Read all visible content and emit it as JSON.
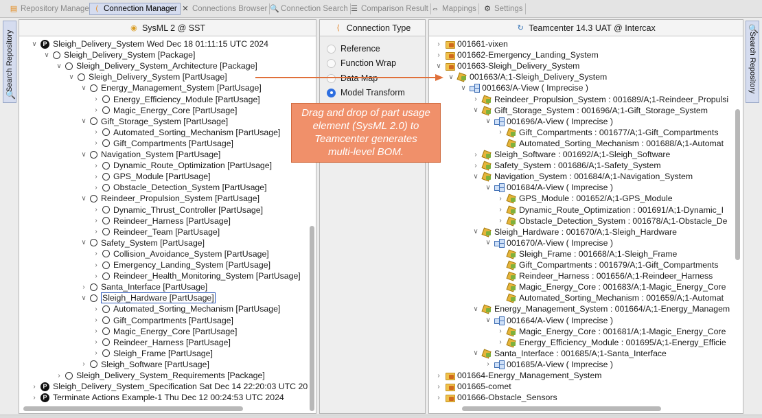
{
  "tabs": [
    {
      "label": "Repository Manager",
      "icon": "database-icon",
      "active": false
    },
    {
      "label": "Connection Manager",
      "icon": "connection-icon",
      "active": true
    },
    {
      "label": "Connections Browser",
      "icon": "cross-arrows-icon",
      "active": false
    },
    {
      "label": "Connection Search",
      "icon": "search-icon",
      "active": false
    },
    {
      "label": "Comparison Result",
      "icon": "list-icon",
      "active": false
    },
    {
      "label": "Mappings",
      "icon": "bidirectional-arrow-icon",
      "active": false
    },
    {
      "label": "Settings",
      "icon": "gear-icon",
      "active": false
    }
  ],
  "side_tabs": {
    "left": "Search Repository",
    "right": "Search Repository"
  },
  "left_panel": {
    "title": "SysML 2 @ SST",
    "rows": [
      {
        "text": "Sleigh_Delivery_System Wed Dec 18 01:11:15 UTC 2024",
        "level": 0,
        "arrow": "v",
        "icon": "p"
      },
      {
        "text": "Sleigh_Delivery_System [Package]",
        "level": 1,
        "arrow": "v",
        "icon": "o"
      },
      {
        "text": "Sleigh_Delivery_System_Architecture [Package]",
        "level": 2,
        "arrow": "v",
        "icon": "o"
      },
      {
        "text": "Sleigh_Delivery_System [PartUsage]",
        "level": 3,
        "arrow": "v",
        "icon": "o"
      },
      {
        "text": "Energy_Management_System [PartUsage]",
        "level": 4,
        "arrow": "v",
        "icon": "o"
      },
      {
        "text": "Energy_Efficiency_Module [PartUsage]",
        "level": 5,
        "arrow": ">",
        "icon": "o"
      },
      {
        "text": "Magic_Energy_Core [PartUsage]",
        "level": 5,
        "arrow": ">",
        "icon": "o"
      },
      {
        "text": "Gift_Storage_System [PartUsage]",
        "level": 4,
        "arrow": "v",
        "icon": "o"
      },
      {
        "text": "Automated_Sorting_Mechanism [PartUsage]",
        "level": 5,
        "arrow": ">",
        "icon": "o"
      },
      {
        "text": "Gift_Compartments [PartUsage]",
        "level": 5,
        "arrow": ">",
        "icon": "o"
      },
      {
        "text": "Navigation_System [PartUsage]",
        "level": 4,
        "arrow": "v",
        "icon": "o"
      },
      {
        "text": "Dynamic_Route_Optimization [PartUsage]",
        "level": 5,
        "arrow": ">",
        "icon": "o"
      },
      {
        "text": "GPS_Module [PartUsage]",
        "level": 5,
        "arrow": ">",
        "icon": "o"
      },
      {
        "text": "Obstacle_Detection_System [PartUsage]",
        "level": 5,
        "arrow": ">",
        "icon": "o"
      },
      {
        "text": "Reindeer_Propulsion_System [PartUsage]",
        "level": 4,
        "arrow": "v",
        "icon": "o"
      },
      {
        "text": "Dynamic_Thrust_Controller [PartUsage]",
        "level": 5,
        "arrow": ">",
        "icon": "o"
      },
      {
        "text": "Reindeer_Harness [PartUsage]",
        "level": 5,
        "arrow": ">",
        "icon": "o"
      },
      {
        "text": "Reindeer_Team [PartUsage]",
        "level": 5,
        "arrow": ">",
        "icon": "o"
      },
      {
        "text": "Safety_System [PartUsage]",
        "level": 4,
        "arrow": "v",
        "icon": "o"
      },
      {
        "text": "Collision_Avoidance_System [PartUsage]",
        "level": 5,
        "arrow": ">",
        "icon": "o"
      },
      {
        "text": "Emergency_Landing_System [PartUsage]",
        "level": 5,
        "arrow": ">",
        "icon": "o"
      },
      {
        "text": "Reindeer_Health_Monitoring_System [PartUsage]",
        "level": 5,
        "arrow": ">",
        "icon": "o"
      },
      {
        "text": "Santa_Interface [PartUsage]",
        "level": 4,
        "arrow": ">",
        "icon": "o"
      },
      {
        "text": "Sleigh_Hardware [PartUsage]",
        "level": 4,
        "arrow": "v",
        "icon": "o",
        "selected": true
      },
      {
        "text": "Automated_Sorting_Mechanism [PartUsage]",
        "level": 5,
        "arrow": ">",
        "icon": "o"
      },
      {
        "text": "Gift_Compartments [PartUsage]",
        "level": 5,
        "arrow": ">",
        "icon": "o"
      },
      {
        "text": "Magic_Energy_Core [PartUsage]",
        "level": 5,
        "arrow": ">",
        "icon": "o"
      },
      {
        "text": "Reindeer_Harness [PartUsage]",
        "level": 5,
        "arrow": ">",
        "icon": "o"
      },
      {
        "text": "Sleigh_Frame [PartUsage]",
        "level": 5,
        "arrow": ">",
        "icon": "o"
      },
      {
        "text": "Sleigh_Software [PartUsage]",
        "level": 4,
        "arrow": ">",
        "icon": "o"
      },
      {
        "text": "Sleigh_Delivery_System_Requirements [Package]",
        "level": 2,
        "arrow": ">",
        "icon": "o"
      },
      {
        "text": "Sleigh_Delivery_System_Specification Sat Dec 14 22:20:03 UTC 20",
        "level": 0,
        "arrow": ">",
        "icon": "p"
      },
      {
        "text": "Terminate Actions Example-1 Thu Dec 12 00:24:53 UTC 2024",
        "level": 0,
        "arrow": ">",
        "icon": "p"
      }
    ]
  },
  "middle_panel": {
    "title": "Connection Type",
    "options": [
      {
        "label": "Reference",
        "selected": false
      },
      {
        "label": "Function Wrap",
        "selected": false
      },
      {
        "label": "Data Map",
        "selected": false
      },
      {
        "label": "Model Transform",
        "selected": true
      }
    ]
  },
  "callout": {
    "lines": [
      "Drag and drop of part usage",
      "element (SysML 2.0) to",
      "Teamcenter generates",
      "multi-level BOM."
    ]
  },
  "right_panel": {
    "title": "Teamcenter 14.3 UAT @ Intercax",
    "rows": [
      {
        "text": "001661-vixen",
        "level": 0,
        "arrow": ">",
        "icon": "folder"
      },
      {
        "text": "001662-Emergency_Landing_System",
        "level": 0,
        "arrow": ">",
        "icon": "folder"
      },
      {
        "text": "001663-Sleigh_Delivery_System",
        "level": 0,
        "arrow": "v",
        "icon": "folder"
      },
      {
        "text": "001663/A;1-Sleigh_Delivery_System",
        "level": 1,
        "arrow": "v",
        "icon": "item"
      },
      {
        "text": "001663/A-View ( Imprecise )",
        "level": 2,
        "arrow": "v",
        "icon": "view"
      },
      {
        "text": "Reindeer_Propulsion_System : 001689/A;1-Reindeer_Propulsi",
        "level": 3,
        "arrow": ">",
        "icon": "item"
      },
      {
        "text": "Gift_Storage_System : 001696/A;1-Gift_Storage_System",
        "level": 3,
        "arrow": "v",
        "icon": "item"
      },
      {
        "text": "001696/A-View ( Imprecise )",
        "level": 4,
        "arrow": "v",
        "icon": "view"
      },
      {
        "text": "Gift_Compartments : 001677/A;1-Gift_Compartments",
        "level": 5,
        "arrow": ">",
        "icon": "item"
      },
      {
        "text": "Automated_Sorting_Mechanism : 001688/A;1-Automat",
        "level": 5,
        "arrow": "",
        "icon": "item"
      },
      {
        "text": "Sleigh_Software : 001692/A;1-Sleigh_Software",
        "level": 3,
        "arrow": ">",
        "icon": "item"
      },
      {
        "text": "Safety_System : 001686/A;1-Safety_System",
        "level": 3,
        "arrow": ">",
        "icon": "item"
      },
      {
        "text": "Navigation_System : 001684/A;1-Navigation_System",
        "level": 3,
        "arrow": "v",
        "icon": "item"
      },
      {
        "text": "001684/A-View ( Imprecise )",
        "level": 4,
        "arrow": "v",
        "icon": "view"
      },
      {
        "text": "GPS_Module : 001652/A;1-GPS_Module",
        "level": 5,
        "arrow": ">",
        "icon": "item"
      },
      {
        "text": "Dynamic_Route_Optimization : 001691/A;1-Dynamic_I",
        "level": 5,
        "arrow": ">",
        "icon": "item"
      },
      {
        "text": "Obstacle_Detection_System : 001678/A;1-Obstacle_De",
        "level": 5,
        "arrow": ">",
        "icon": "item"
      },
      {
        "text": "Sleigh_Hardware : 001670/A;1-Sleigh_Hardware",
        "level": 3,
        "arrow": "v",
        "icon": "item"
      },
      {
        "text": "001670/A-View ( Imprecise )",
        "level": 4,
        "arrow": "v",
        "icon": "view"
      },
      {
        "text": "Sleigh_Frame : 001668/A;1-Sleigh_Frame",
        "level": 5,
        "arrow": "",
        "icon": "item"
      },
      {
        "text": "Gift_Compartments : 001679/A;1-Gift_Compartments",
        "level": 5,
        "arrow": "",
        "icon": "item"
      },
      {
        "text": "Reindeer_Harness : 001656/A;1-Reindeer_Harness",
        "level": 5,
        "arrow": "",
        "icon": "item"
      },
      {
        "text": "Magic_Energy_Core : 001683/A;1-Magic_Energy_Core",
        "level": 5,
        "arrow": "",
        "icon": "item"
      },
      {
        "text": "Automated_Sorting_Mechanism : 001659/A;1-Automat",
        "level": 5,
        "arrow": "",
        "icon": "item"
      },
      {
        "text": "Energy_Management_System : 001664/A;1-Energy_Managem",
        "level": 3,
        "arrow": "v",
        "icon": "item"
      },
      {
        "text": "001664/A-View ( Imprecise )",
        "level": 4,
        "arrow": "v",
        "icon": "view"
      },
      {
        "text": "Magic_Energy_Core : 001681/A;1-Magic_Energy_Core",
        "level": 5,
        "arrow": ">",
        "icon": "item"
      },
      {
        "text": "Energy_Efficiency_Module : 001695/A;1-Energy_Efficie",
        "level": 5,
        "arrow": ">",
        "icon": "item"
      },
      {
        "text": "Santa_Interface : 001685/A;1-Santa_Interface",
        "level": 3,
        "arrow": "v",
        "icon": "item"
      },
      {
        "text": "001685/A-View ( Imprecise )",
        "level": 4,
        "arrow": ">",
        "icon": "view"
      },
      {
        "text": "001664-Energy_Management_System",
        "level": 0,
        "arrow": ">",
        "icon": "folder"
      },
      {
        "text": "001665-comet",
        "level": 0,
        "arrow": ">",
        "icon": "folder"
      },
      {
        "text": "001666-Obstacle_Sensors",
        "level": 0,
        "arrow": ">",
        "icon": "folder"
      }
    ]
  }
}
